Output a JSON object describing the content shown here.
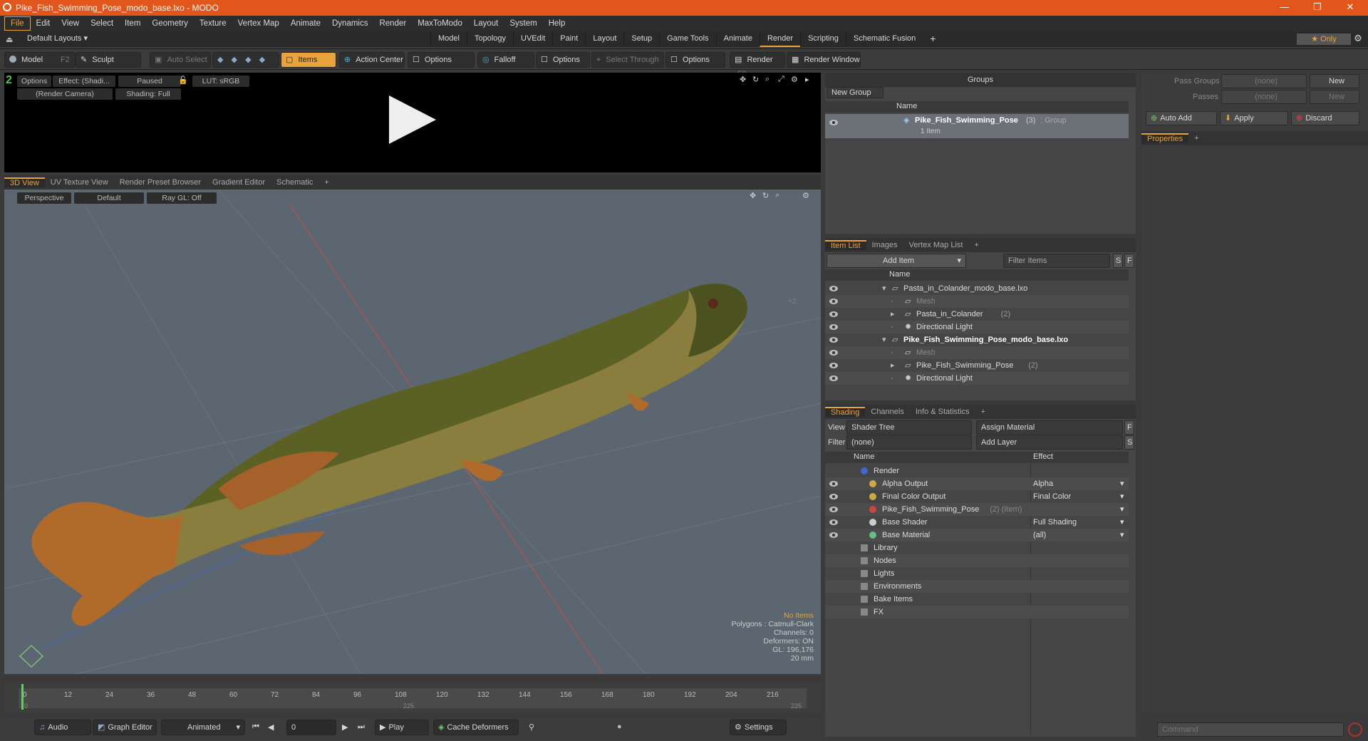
{
  "window": {
    "title": "Pike_Fish_Swimming_Pose_modo_base.lxo - MODO",
    "minimize": "—",
    "restore": "❐",
    "close": "✕"
  },
  "menu": [
    "File",
    "Edit",
    "View",
    "Select",
    "Item",
    "Geometry",
    "Texture",
    "Vertex Map",
    "Animate",
    "Dynamics",
    "Render",
    "MaxToModo",
    "Layout",
    "System",
    "Help"
  ],
  "layoutbar": {
    "layouts_label": "Default Layouts ▾",
    "tabs": [
      "Model",
      "Topology",
      "UVEdit",
      "Paint",
      "Layout",
      "Setup",
      "Game Tools",
      "Animate",
      "Render",
      "Scripting",
      "Schematic Fusion"
    ],
    "active_tab": "Render",
    "add": "+",
    "only": "★ Only"
  },
  "toolbar": {
    "model": "Model",
    "model_key": "F2",
    "sculpt": "Sculpt",
    "auto_select": "Auto Select",
    "items": "Items",
    "action_center": "Action Center",
    "options1": "Options",
    "falloff": "Falloff",
    "options2": "Options",
    "select_through": "Select Through",
    "options3": "Options",
    "render": "Render",
    "render_key": "F9",
    "render_window": "Render Window"
  },
  "render_view": {
    "options": "Options",
    "effect": "Effect: (Shadi...",
    "paused": "Paused",
    "lut": "LUT: sRGB",
    "camera": "(Render Camera)",
    "shading": "Shading: Full"
  },
  "viewport_tabs": [
    "3D View",
    "UV Texture View",
    "Render Preset Browser",
    "Gradient Editor",
    "Schematic"
  ],
  "viewport": {
    "perspective": "Perspective",
    "default": "Default",
    "raygl": "Ray GL: Off",
    "hud": [
      "No Items",
      "Polygons : Catmull-Clark",
      "Channels: 0",
      "Deformers: ON",
      "GL: 196,176",
      "20 mm"
    ],
    "corner_label": "+2"
  },
  "timeline": {
    "ticks": [
      "0",
      "12",
      "24",
      "36",
      "48",
      "60",
      "72",
      "84",
      "96",
      "108",
      "120",
      "132",
      "144",
      "156",
      "168",
      "180",
      "192",
      "204",
      "216"
    ],
    "sub_ticks": [
      "0",
      "225",
      "225"
    ]
  },
  "bottombar": {
    "audio": "Audio",
    "graph_editor": "Graph Editor",
    "animated": "Animated",
    "frame": "0",
    "play": "Play",
    "cache_deformers": "Cache Deformers",
    "settings": "Settings"
  },
  "groups": {
    "title": "Groups",
    "new_group": "New Group",
    "col_name": "Name",
    "item": "Pike_Fish_Swimming_Pose",
    "item_count": "(3)",
    "item_type": ": Group",
    "item_sub": "1 Item"
  },
  "item_list": {
    "tabs": [
      "Item List",
      "Images",
      "Vertex Map List"
    ],
    "add_item": "Add Item",
    "filter": "Filter Items",
    "s": "S",
    "f": "F",
    "col_name": "Name",
    "rows": [
      {
        "label": "Pasta_in_Colander_modo_base.lxo",
        "indent": 0,
        "bold": false,
        "dim": false
      },
      {
        "label": "Mesh",
        "indent": 1,
        "bold": false,
        "dim": true
      },
      {
        "label": "Pasta_in_Colander",
        "suffix": "(2)",
        "indent": 1,
        "bold": false,
        "dim": false
      },
      {
        "label": "Directional Light",
        "indent": 1,
        "bold": false,
        "dim": false
      },
      {
        "label": "Pike_Fish_Swimming_Pose_modo_base.lxo",
        "indent": 0,
        "bold": true,
        "dim": false
      },
      {
        "label": "Mesh",
        "indent": 1,
        "bold": false,
        "dim": true
      },
      {
        "label": "Pike_Fish_Swimming_Pose",
        "suffix": "(2)",
        "indent": 1,
        "bold": false,
        "dim": false
      },
      {
        "label": "Directional Light",
        "indent": 1,
        "bold": false,
        "dim": false
      }
    ]
  },
  "shading": {
    "tabs": [
      "Shading",
      "Channels",
      "Info & Statistics"
    ],
    "view_label": "View",
    "view_value": "Shader Tree",
    "assign_material": "Assign Material",
    "f": "F",
    "filter_label": "Filter",
    "filter_value": "(none)",
    "add_layer": "Add Layer",
    "s": "S",
    "col_name": "Name",
    "col_effect": "Effect",
    "rows": [
      {
        "label": "Render",
        "effect": "",
        "indent": 0
      },
      {
        "label": "Alpha Output",
        "effect": "Alpha",
        "indent": 1
      },
      {
        "label": "Final Color Output",
        "effect": "Final Color",
        "indent": 1
      },
      {
        "label": "Pike_Fish_Swimming_Pose",
        "suffix": "(2) (Item)",
        "effect": "",
        "indent": 1
      },
      {
        "label": "Base Shader",
        "effect": "Full Shading",
        "indent": 1
      },
      {
        "label": "Base Material",
        "effect": "(all)",
        "indent": 1
      },
      {
        "label": "Library",
        "effect": "",
        "indent": 0
      },
      {
        "label": "Nodes",
        "effect": "",
        "indent": 0
      },
      {
        "label": "Lights",
        "effect": "",
        "indent": 0
      },
      {
        "label": "Environments",
        "effect": "",
        "indent": 0
      },
      {
        "label": "Bake Items",
        "effect": "",
        "indent": 0
      },
      {
        "label": "FX",
        "effect": "",
        "indent": 0
      }
    ]
  },
  "pass_panel": {
    "pass_groups": "Pass Groups",
    "passes": "Passes",
    "none": "(none)",
    "new": "New",
    "auto_add": "Auto Add",
    "apply": "Apply",
    "discard": "Discard",
    "properties": "Properties"
  },
  "command": {
    "placeholder": "Command"
  },
  "colors": {
    "accent": "#e8a33a",
    "titlebar": "#e2561b"
  }
}
